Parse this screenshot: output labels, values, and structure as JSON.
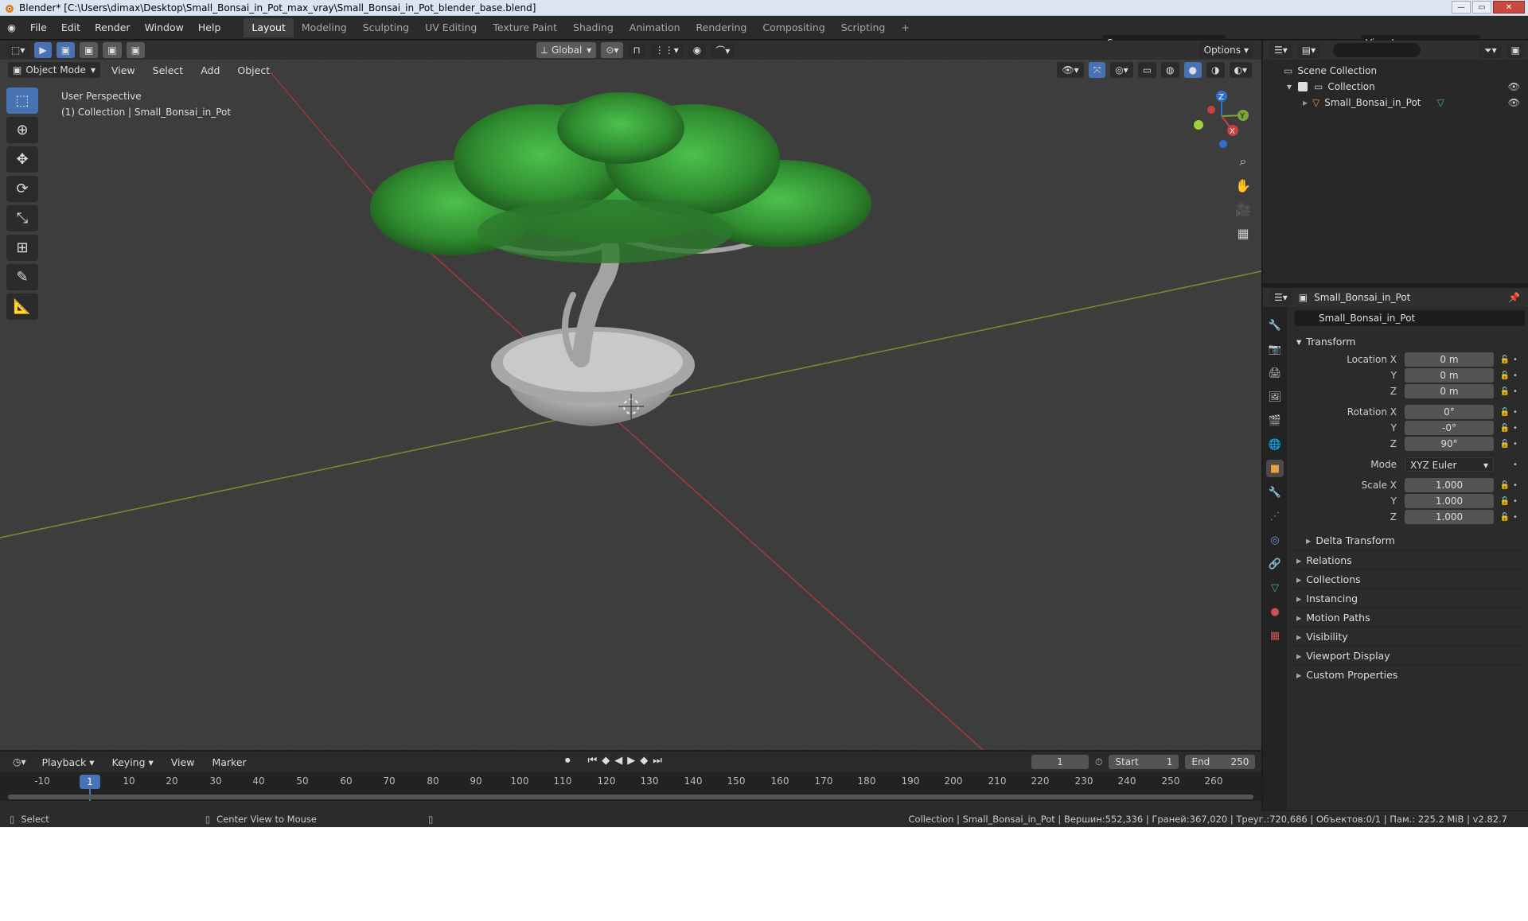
{
  "title": "Blender* [C:\\Users\\dimax\\Desktop\\Small_Bonsai_in_Pot_max_vray\\Small_Bonsai_in_Pot_blender_base.blend]",
  "menu": [
    "File",
    "Edit",
    "Render",
    "Window",
    "Help"
  ],
  "workspaces": [
    "Layout",
    "Modeling",
    "Sculpting",
    "UV Editing",
    "Texture Paint",
    "Shading",
    "Animation",
    "Rendering",
    "Compositing",
    "Scripting",
    "+"
  ],
  "scene_name": "Scene",
  "view_layer": "View Layer",
  "viewport": {
    "mode": "Object Mode",
    "menus": [
      "View",
      "Select",
      "Add",
      "Object"
    ],
    "transform_orientation": "Global",
    "options_label": "Options",
    "perspective": "User Perspective",
    "collection_info": "(1) Collection | Small_Bonsai_in_Pot",
    "axes": {
      "z": "Z",
      "y": "Y",
      "x": "X"
    }
  },
  "outliner": {
    "root": "Scene Collection",
    "collection": "Collection",
    "object": "Small_Bonsai_in_Pot"
  },
  "properties": {
    "object_name": "Small_Bonsai_in_Pot",
    "datablock_name": "Small_Bonsai_in_Pot",
    "transform_title": "Transform",
    "location_label": "Location X",
    "location": [
      "0 m",
      "0 m",
      "0 m"
    ],
    "rotation_label": "Rotation X",
    "rotation": [
      "0°",
      "-0°",
      "90°"
    ],
    "mode_label": "Mode",
    "mode_value": "XYZ Euler",
    "scale_label": "Scale X",
    "scale": [
      "1.000",
      "1.000",
      "1.000"
    ],
    "y_label": "Y",
    "z_label": "Z",
    "delta_transform": "Delta Transform",
    "panels": [
      "Relations",
      "Collections",
      "Instancing",
      "Motion Paths",
      "Visibility",
      "Viewport Display",
      "Custom Properties"
    ]
  },
  "timeline": {
    "menus": [
      "Playback",
      "Keying",
      "View",
      "Marker"
    ],
    "current_frame": "1",
    "start_label": "Start",
    "start": "1",
    "end_label": "End",
    "end": "250",
    "ruler": [
      "-10",
      "1",
      "10",
      "20",
      "30",
      "40",
      "50",
      "60",
      "70",
      "80",
      "90",
      "100",
      "110",
      "120",
      "130",
      "140",
      "150",
      "160",
      "170",
      "180",
      "190",
      "200",
      "210",
      "220",
      "230",
      "240",
      "250",
      "260"
    ]
  },
  "status": {
    "left": "Select",
    "middle": "Center View to Mouse",
    "right": "Collection | Small_Bonsai_in_Pot | Вершин:552,336 | Граней:367,020 | Треуг.:720,686 | Объектов:0/1 | Пам.: 225.2 MiB | v2.82.7"
  },
  "colors": {
    "accent": "#4772b3",
    "x_axis": "#c94040",
    "y_axis": "#7ca53b",
    "z_axis": "#2f6fce",
    "foliage": "#3c9a3c"
  }
}
